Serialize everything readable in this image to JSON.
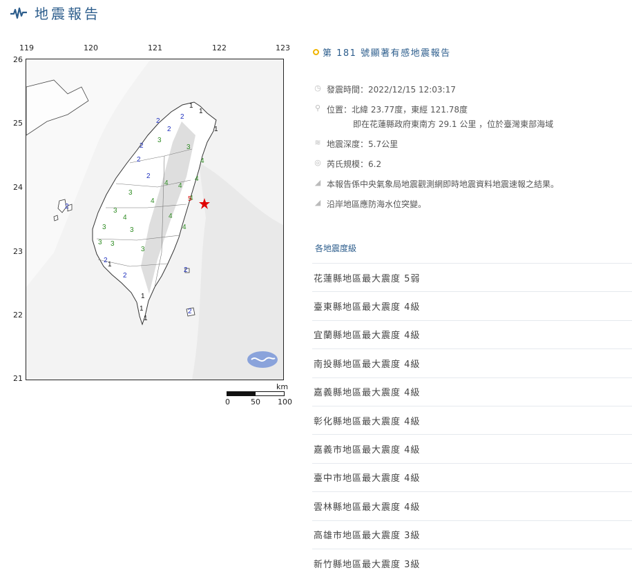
{
  "header": {
    "title": "地震報告"
  },
  "map": {
    "longitudes": [
      "119",
      "120",
      "121",
      "122",
      "123"
    ],
    "latitudes": [
      "26",
      "25",
      "24",
      "23",
      "22",
      "21"
    ],
    "scale": {
      "unit": "km",
      "labels": [
        "0",
        "50",
        "100"
      ]
    },
    "epicenter_marker": "red-star-icon",
    "intensity_labels": [
      {
        "v": "1",
        "c": "#111"
      },
      {
        "v": "2",
        "c": "#1d2fbe"
      },
      {
        "v": "3",
        "c": "#2e8b22"
      },
      {
        "v": "4",
        "c": "#2e8b22"
      },
      {
        "v": "5",
        "c": "#d11"
      }
    ],
    "colors": {
      "level1": "#111111",
      "level2": "#1d2fbe",
      "level3": "#2e8b22",
      "level4": "#2e8b22",
      "level5": "#dd1111"
    }
  },
  "report": {
    "title": "第 181 號顯著有感地震報告",
    "time_label": "發震時間：2022/12/15 12:03:17",
    "location_line1": "位置：北緯 23.77度，東經 121.78度",
    "location_line2": "即在花蓮縣政府東南方 29.1 公里 ，位於臺灣東部海域",
    "depth": "地震深度：5.7公里",
    "magnitude": "芮氏規模：6.2",
    "note1": "本報告係中央氣象局地震觀測網即時地震資料地震速報之結果。",
    "note2": "沿岸地區應防海水位突變。"
  },
  "intensity": {
    "section_title": "各地震度級",
    "rows": [
      "花蓮縣地區最大震度 5弱",
      "臺東縣地區最大震度 4級",
      "宜蘭縣地區最大震度 4級",
      "南投縣地區最大震度 4級",
      "嘉義縣地區最大震度 4級",
      "彰化縣地區最大震度 4級",
      "嘉義市地區最大震度 4級",
      "臺中市地區最大震度 4級",
      "雲林縣地區最大震度 4級",
      "高雄市地區最大震度 3級",
      "新竹縣地區最大震度 3級"
    ]
  }
}
